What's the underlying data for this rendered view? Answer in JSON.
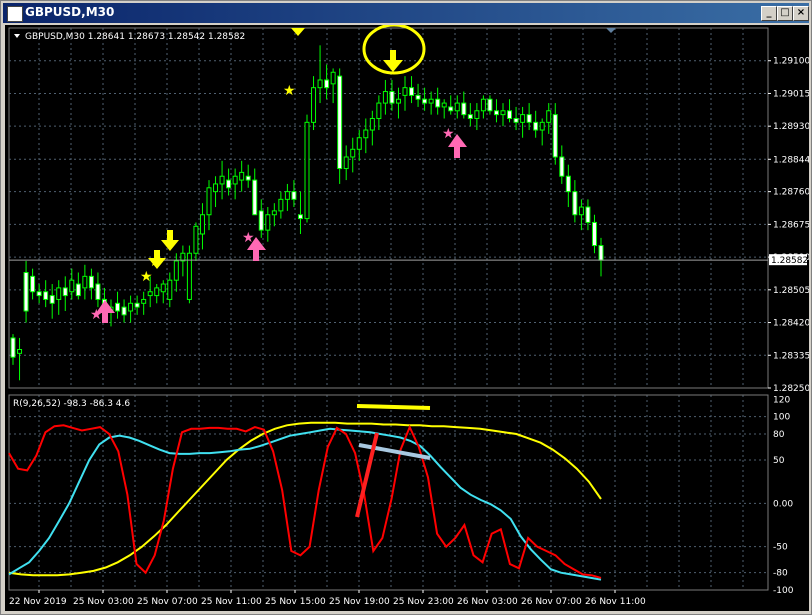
{
  "window": {
    "title": "GBPUSD,M30",
    "buttons": [
      "_",
      "□",
      "×"
    ]
  },
  "price_panel": {
    "symbol_info": "GBPUSD,M30  1.28641 1.28673 1.28542 1.28582",
    "current_price": "1.28582",
    "y_labels": [
      "1.29100",
      "1.29015",
      "1.28930",
      "1.28844",
      "1.28760",
      "1.28675",
      "1.28590",
      "1.28505",
      "1.28420",
      "1.28335",
      "1.28250"
    ]
  },
  "indicator_panel": {
    "label": "R(9,26,52) -98.3 -86.3 4.6",
    "y_labels": [
      "120",
      "100",
      "80",
      "50",
      "0.00",
      "-50",
      "-80",
      "-100"
    ]
  },
  "time_axis": [
    "22 Nov 2019",
    "25 Nov 03:00",
    "25 Nov 07:00",
    "25 Nov 11:00",
    "25 Nov 15:00",
    "25 Nov 19:00",
    "25 Nov 23:00",
    "26 Nov 03:00",
    "26 Nov 07:00",
    "26 Nov 11:00"
  ],
  "colors": {
    "grid": "#506070",
    "bull": "#00ff00",
    "bear": "#ffffff",
    "red_line": "#ff0000",
    "cyan_line": "#40e0f0",
    "yellow_line": "#ffff00",
    "arrow_up": "#ff69b4",
    "arrow_down": "#ffff00"
  },
  "icons": {
    "down_arrow": "arrow-down-icon",
    "up_arrow": "arrow-up-icon",
    "star": "star-icon"
  },
  "chart_data": {
    "type": "candlestick",
    "ohlc": [
      [
        1.2838,
        1.2839,
        1.2831,
        1.2833
      ],
      [
        1.2834,
        1.2838,
        1.2827,
        1.2835
      ],
      [
        1.2855,
        1.2858,
        1.2842,
        1.2845
      ],
      [
        1.2854,
        1.2856,
        1.2848,
        1.285
      ],
      [
        1.285,
        1.2852,
        1.2847,
        1.2849
      ],
      [
        1.285,
        1.2853,
        1.2846,
        1.2848
      ],
      [
        1.2849,
        1.2852,
        1.2843,
        1.2847
      ],
      [
        1.2848,
        1.2853,
        1.2844,
        1.2851
      ],
      [
        1.2851,
        1.2854,
        1.2845,
        1.2849
      ],
      [
        1.285,
        1.2856,
        1.2848,
        1.2853
      ],
      [
        1.2852,
        1.2855,
        1.2848,
        1.2849
      ],
      [
        1.2851,
        1.2857,
        1.2848,
        1.2854
      ],
      [
        1.2854,
        1.2856,
        1.2848,
        1.2851
      ],
      [
        1.2852,
        1.2855,
        1.2846,
        1.2848
      ],
      [
        1.2848,
        1.2851,
        1.2842,
        1.2844
      ],
      [
        1.2845,
        1.2848,
        1.2841,
        1.2846
      ],
      [
        1.2847,
        1.285,
        1.2843,
        1.2845
      ],
      [
        1.2846,
        1.2848,
        1.2842,
        1.2844
      ],
      [
        1.2845,
        1.2849,
        1.2842,
        1.2847
      ],
      [
        1.2847,
        1.2849,
        1.2844,
        1.2846
      ],
      [
        1.2847,
        1.285,
        1.2844,
        1.2848
      ],
      [
        1.2849,
        1.2854,
        1.2846,
        1.285
      ],
      [
        1.2849,
        1.2852,
        1.2847,
        1.2851
      ],
      [
        1.285,
        1.2853,
        1.2847,
        1.2852
      ],
      [
        1.2848,
        1.2855,
        1.2846,
        1.2853
      ],
      [
        1.2853,
        1.286,
        1.285,
        1.2858
      ],
      [
        1.2858,
        1.2862,
        1.2854,
        1.286
      ],
      [
        1.2848,
        1.2862,
        1.2847,
        1.286
      ],
      [
        1.286,
        1.2868,
        1.2858,
        1.2867
      ],
      [
        1.2865,
        1.2873,
        1.2861,
        1.287
      ],
      [
        1.287,
        1.2879,
        1.2866,
        1.2877
      ],
      [
        1.2876,
        1.288,
        1.2872,
        1.2878
      ],
      [
        1.2878,
        1.2884,
        1.2874,
        1.288
      ],
      [
        1.2879,
        1.2882,
        1.2875,
        1.2877
      ],
      [
        1.2878,
        1.2882,
        1.2874,
        1.288
      ],
      [
        1.2879,
        1.2884,
        1.2876,
        1.2881
      ],
      [
        1.288,
        1.2883,
        1.2877,
        1.2879
      ],
      [
        1.2879,
        1.2882,
        1.2874,
        1.287
      ],
      [
        1.2871,
        1.2874,
        1.2864,
        1.2866
      ],
      [
        1.2866,
        1.2872,
        1.2863,
        1.287
      ],
      [
        1.287,
        1.2873,
        1.2867,
        1.2871
      ],
      [
        1.2871,
        1.2876,
        1.2869,
        1.2874
      ],
      [
        1.2874,
        1.2878,
        1.2871,
        1.2876
      ],
      [
        1.2876,
        1.2879,
        1.2872,
        1.2874
      ],
      [
        1.287,
        1.2876,
        1.2865,
        1.2869
      ],
      [
        1.2869,
        1.2896,
        1.2868,
        1.2894
      ],
      [
        1.2894,
        1.2906,
        1.2892,
        1.2903
      ],
      [
        1.2903,
        1.2914,
        1.2899,
        1.2905
      ],
      [
        1.2905,
        1.2909,
        1.29,
        1.2903
      ],
      [
        1.2904,
        1.2908,
        1.2899,
        1.2907
      ],
      [
        1.2906,
        1.2908,
        1.2878,
        1.2882
      ],
      [
        1.2882,
        1.2888,
        1.2879,
        1.2885
      ],
      [
        1.2885,
        1.289,
        1.2881,
        1.2887
      ],
      [
        1.2887,
        1.2892,
        1.2884,
        1.289
      ],
      [
        1.289,
        1.2895,
        1.2886,
        1.2892
      ],
      [
        1.2892,
        1.2897,
        1.2888,
        1.2895
      ],
      [
        1.2895,
        1.2901,
        1.2892,
        1.2899
      ],
      [
        1.2899,
        1.2905,
        1.2896,
        1.2902
      ],
      [
        1.2902,
        1.2905,
        1.2897,
        1.2899
      ],
      [
        1.2899,
        1.2903,
        1.2895,
        1.29
      ],
      [
        1.2901,
        1.2906,
        1.2897,
        1.2903
      ],
      [
        1.2903,
        1.2906,
        1.2899,
        1.2901
      ],
      [
        1.2901,
        1.2904,
        1.2898,
        1.29
      ],
      [
        1.29,
        1.2903,
        1.2897,
        1.2899
      ],
      [
        1.2899,
        1.2902,
        1.2896,
        1.29
      ],
      [
        1.29,
        1.2903,
        1.2896,
        1.2898
      ],
      [
        1.2898,
        1.29,
        1.2895,
        1.2899
      ],
      [
        1.2898,
        1.2901,
        1.2896,
        1.2897
      ],
      [
        1.2897,
        1.2901,
        1.2895,
        1.2899
      ],
      [
        1.2899,
        1.2902,
        1.2895,
        1.2896
      ],
      [
        1.2896,
        1.2899,
        1.2893,
        1.2895
      ],
      [
        1.2895,
        1.2899,
        1.2892,
        1.2897
      ],
      [
        1.2897,
        1.2901,
        1.2895,
        1.29
      ],
      [
        1.29,
        1.2901,
        1.2896,
        1.2897
      ],
      [
        1.2897,
        1.29,
        1.2894,
        1.2896
      ],
      [
        1.2896,
        1.2899,
        1.2893,
        1.2897
      ],
      [
        1.2897,
        1.29,
        1.2894,
        1.2895
      ],
      [
        1.2895,
        1.2898,
        1.2892,
        1.2894
      ],
      [
        1.2894,
        1.2898,
        1.289,
        1.2896
      ],
      [
        1.2896,
        1.2899,
        1.2892,
        1.2894
      ],
      [
        1.2894,
        1.2897,
        1.289,
        1.2892
      ],
      [
        1.2892,
        1.2895,
        1.2888,
        1.2894
      ],
      [
        1.2894,
        1.2899,
        1.2891,
        1.2897
      ],
      [
        1.2896,
        1.2899,
        1.2883,
        1.2885
      ],
      [
        1.2885,
        1.2888,
        1.2878,
        1.288
      ],
      [
        1.288,
        1.2883,
        1.2872,
        1.2876
      ],
      [
        1.2876,
        1.2879,
        1.2868,
        1.287
      ],
      [
        1.287,
        1.2874,
        1.2866,
        1.2872
      ],
      [
        1.2872,
        1.2874,
        1.2866,
        1.2868
      ],
      [
        1.2868,
        1.287,
        1.286,
        1.2862
      ],
      [
        1.2862,
        1.2864,
        1.2854,
        1.28582
      ]
    ],
    "price_ylim": [
      1.2825,
      1.29185
    ],
    "indicator_ylim": [
      -100,
      125
    ],
    "red_series": [
      58,
      40,
      38,
      55,
      82,
      89,
      90,
      87,
      84,
      86,
      88,
      80,
      60,
      10,
      -70,
      -80,
      -60,
      -20,
      40,
      82,
      86,
      86,
      87,
      87,
      86,
      86,
      83,
      88,
      85,
      60,
      15,
      -55,
      -60,
      -50,
      15,
      65,
      87,
      80,
      58,
      10,
      -55,
      -40,
      5,
      62,
      88,
      65,
      30,
      -35,
      -50,
      -40,
      -25,
      -60,
      -68,
      -35,
      -30,
      -70,
      -75,
      -40,
      -50,
      -55,
      -60,
      -70,
      -76,
      -82,
      -83,
      -86
    ],
    "cyan_series": [
      -82,
      -75,
      -68,
      -55,
      -40,
      -20,
      0,
      25,
      50,
      68,
      76,
      78,
      76,
      72,
      67,
      62,
      58,
      57,
      57,
      58,
      58,
      59,
      60,
      62,
      63,
      66,
      70,
      74,
      78,
      80,
      82,
      84,
      86,
      85,
      84,
      83,
      82,
      80,
      78,
      76,
      72,
      66,
      55,
      42,
      30,
      18,
      10,
      4,
      -1,
      -8,
      -18,
      -38,
      -53,
      -65,
      -76,
      -80,
      -82,
      -84,
      -86,
      -88
    ],
    "yellow_series": [
      -80,
      -82,
      -83,
      -83,
      -83,
      -82,
      -80,
      -78,
      -74,
      -68,
      -60,
      -50,
      -38,
      -25,
      -10,
      5,
      20,
      35,
      50,
      62,
      72,
      80,
      86,
      90,
      92,
      93,
      93,
      93,
      92,
      92,
      92,
      91,
      91,
      90,
      90,
      89,
      89,
      88,
      87,
      86,
      84,
      82,
      80,
      75,
      70,
      62,
      52,
      40,
      25,
      5
    ]
  }
}
